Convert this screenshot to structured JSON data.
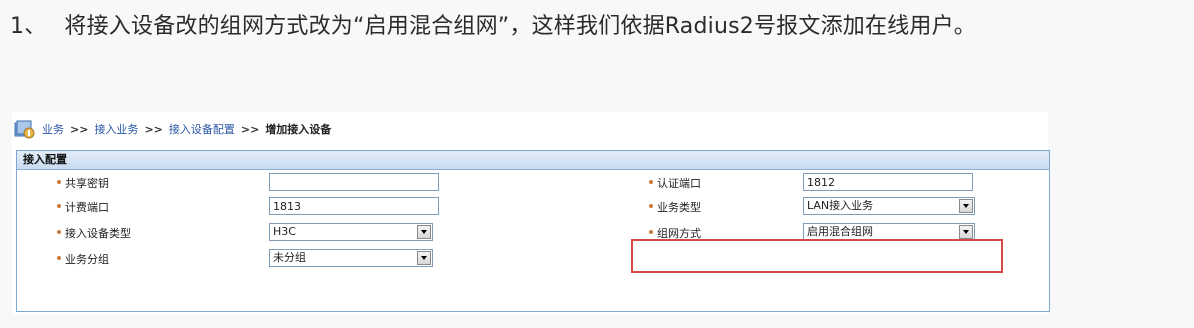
{
  "article": {
    "step_number": "1、",
    "step_text": "将接入设备改的组网方式改为“启用混合组网”，这样我们依据Radius2号报文添加在线用户。"
  },
  "breadcrumb": {
    "items": [
      "业务",
      "接入业务",
      "接入设备配置"
    ],
    "separator": ">>",
    "current": "增加接入设备"
  },
  "panel": {
    "title": "接入配置",
    "fields": {
      "shared_key": {
        "label": "共享密钥",
        "value": ""
      },
      "auth_port": {
        "label": "认证端口",
        "value": "1812"
      },
      "acct_port": {
        "label": "计费端口",
        "value": "1813"
      },
      "service_type": {
        "label": "业务类型",
        "value": "LAN接入业务"
      },
      "device_type": {
        "label": "接入设备类型",
        "value": "H3C"
      },
      "network_mode": {
        "label": "组网方式",
        "value": "启用混合组网"
      },
      "service_group": {
        "label": "业务分组",
        "value": "未分组"
      }
    }
  },
  "colors": {
    "accent_link": "#2a56a6",
    "highlight_border": "#d84a4a",
    "panel_header": "#c8dbf1"
  }
}
